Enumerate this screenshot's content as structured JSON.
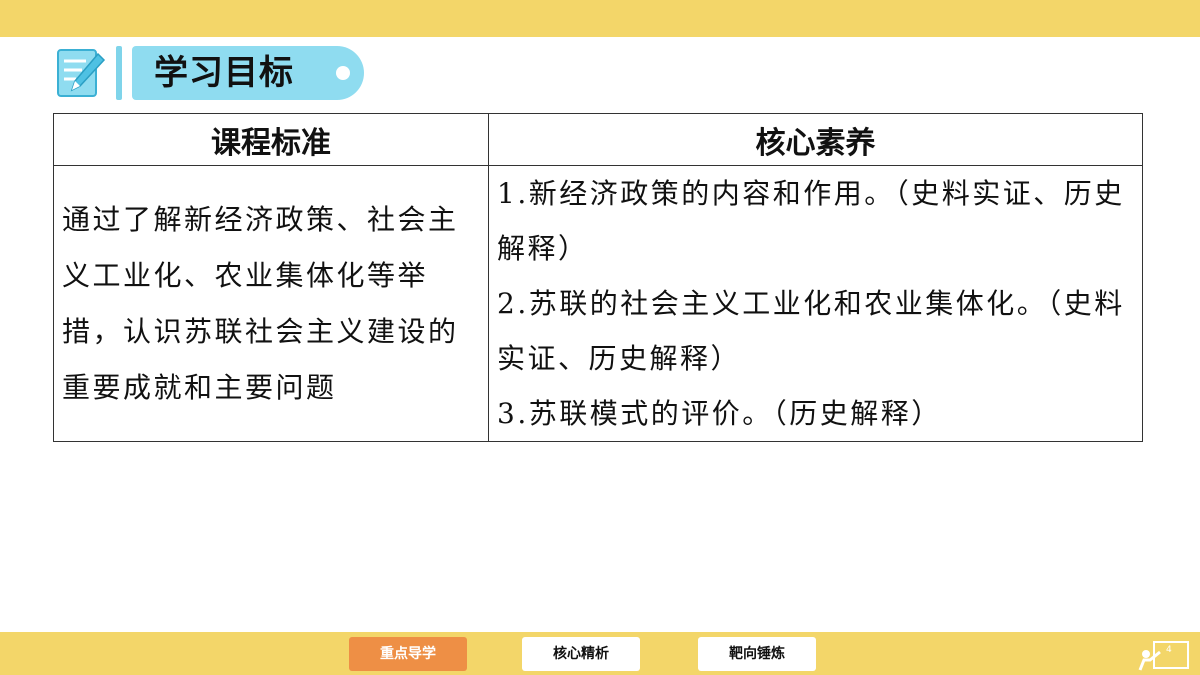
{
  "header": {
    "title": "学习目标"
  },
  "table": {
    "headers": [
      "课程标准",
      "核心素养"
    ],
    "standard": "通过了解新经济政策、社会主义工业化、农业集体化等举措，认识苏联社会主义建设的重要成就和主要问题",
    "literacy": [
      "1.新经济政策的内容和作用。（史料实证、历史解释）",
      "2.苏联的社会主义工业化和农业集体化。（史料实证、历史解释）",
      "3.苏联模式的评价。（历史解释）"
    ]
  },
  "nav": {
    "buttons": [
      "重点导学",
      "核心精析",
      "靶向锤炼"
    ],
    "active": "重点导学"
  },
  "page_number": "4",
  "colors": {
    "bar": "#f3d669",
    "pill": "#8fdcf0",
    "active_button": "#ee8f45"
  }
}
